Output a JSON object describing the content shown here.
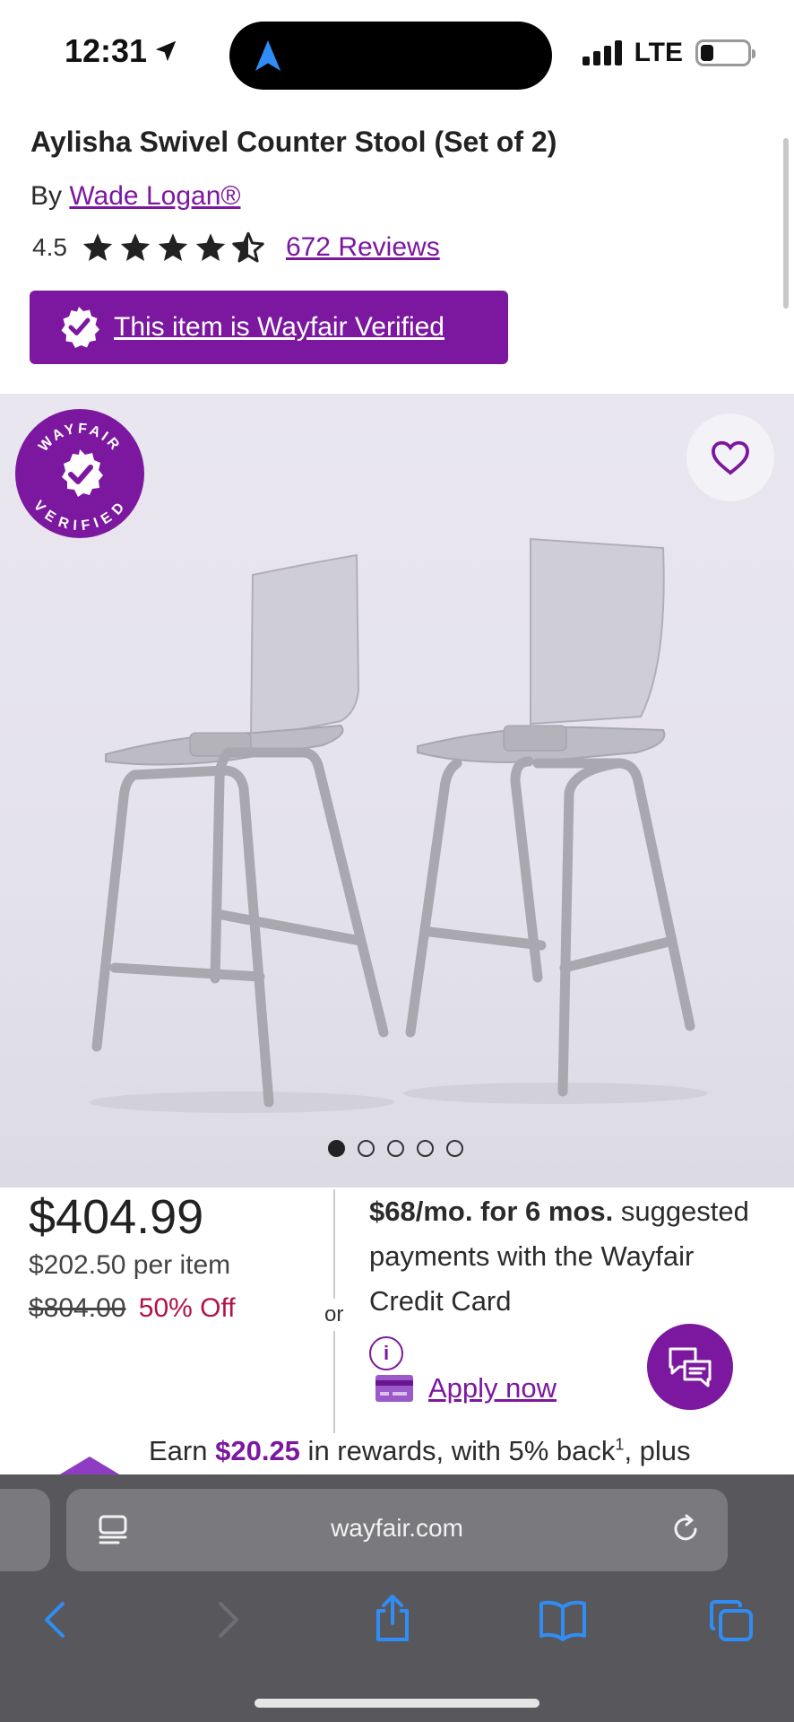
{
  "status": {
    "time": "12:31",
    "network": "LTE"
  },
  "product": {
    "title": "Aylisha Swivel Counter Stool (Set of 2)",
    "by_prefix": "By",
    "brand": "Wade Logan®",
    "rating": "4.5",
    "reviews": "672 Reviews",
    "verified_text": "This item is Wayfair Verified"
  },
  "badge": {
    "top": "WAYFAIR",
    "bottom": "VERIFIED"
  },
  "gallery": {
    "image_count": 5,
    "active_index": 0
  },
  "pricing": {
    "price": "$404.99",
    "per_item": "$202.50 per item",
    "was": "$804.00",
    "off": "50% Off",
    "or": "or",
    "finance_bold": "$68/mo. for 6 mos.",
    "finance_rest": " suggested payments with the Wayfair Credit Card",
    "apply": "Apply now"
  },
  "rewards": {
    "prefix": "Earn ",
    "amount": "$20.25",
    "middle": " in rewards, with 5% back",
    "sup": "1",
    "suffix": ", plus"
  },
  "browser": {
    "url": "wayfair.com"
  },
  "colors": {
    "brand": "#7b189f",
    "sale": "#b3124a"
  }
}
